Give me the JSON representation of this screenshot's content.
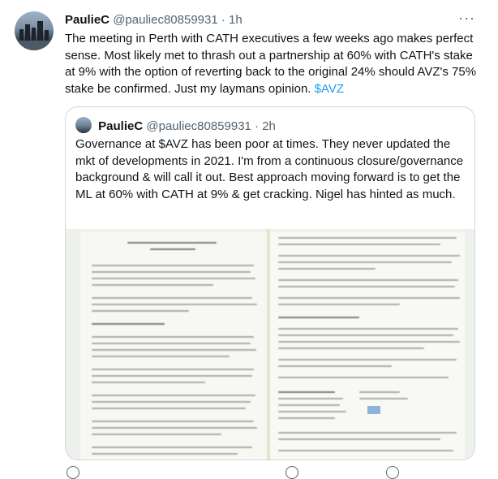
{
  "tweet": {
    "author_name": "PaulieC",
    "author_handle": "@pauliec80859931",
    "separator": "·",
    "time": "1h",
    "more_glyph": "···",
    "text_main": "The meeting in Perth with CATH executives a few weeks ago makes perfect sense. Most likely met to thrash out a partnership at 60% with CATH's stake at 9% with the option of reverting back to the original 24% should AVZ's 75% stake be confirmed. Just my laymans opinion. ",
    "cashtag": "$AVZ"
  },
  "quote": {
    "author_name": "PaulieC",
    "author_handle": "@pauliec80859931",
    "separator": "·",
    "time": "2h",
    "text": "Governance at $AVZ has been poor at times.  They never updated the mkt of developments in 2021. I'm from a continuous closure/governance background & will call it out.  Best approach moving forward is to get the ML at 60% with CATH at 9% & get cracking. Nigel has hinted as much.",
    "image_icon": "document-photo"
  },
  "colors": {
    "text": "#0f1419",
    "secondary": "#536471",
    "link": "#1d9bf0",
    "border": "#cfd9de"
  }
}
